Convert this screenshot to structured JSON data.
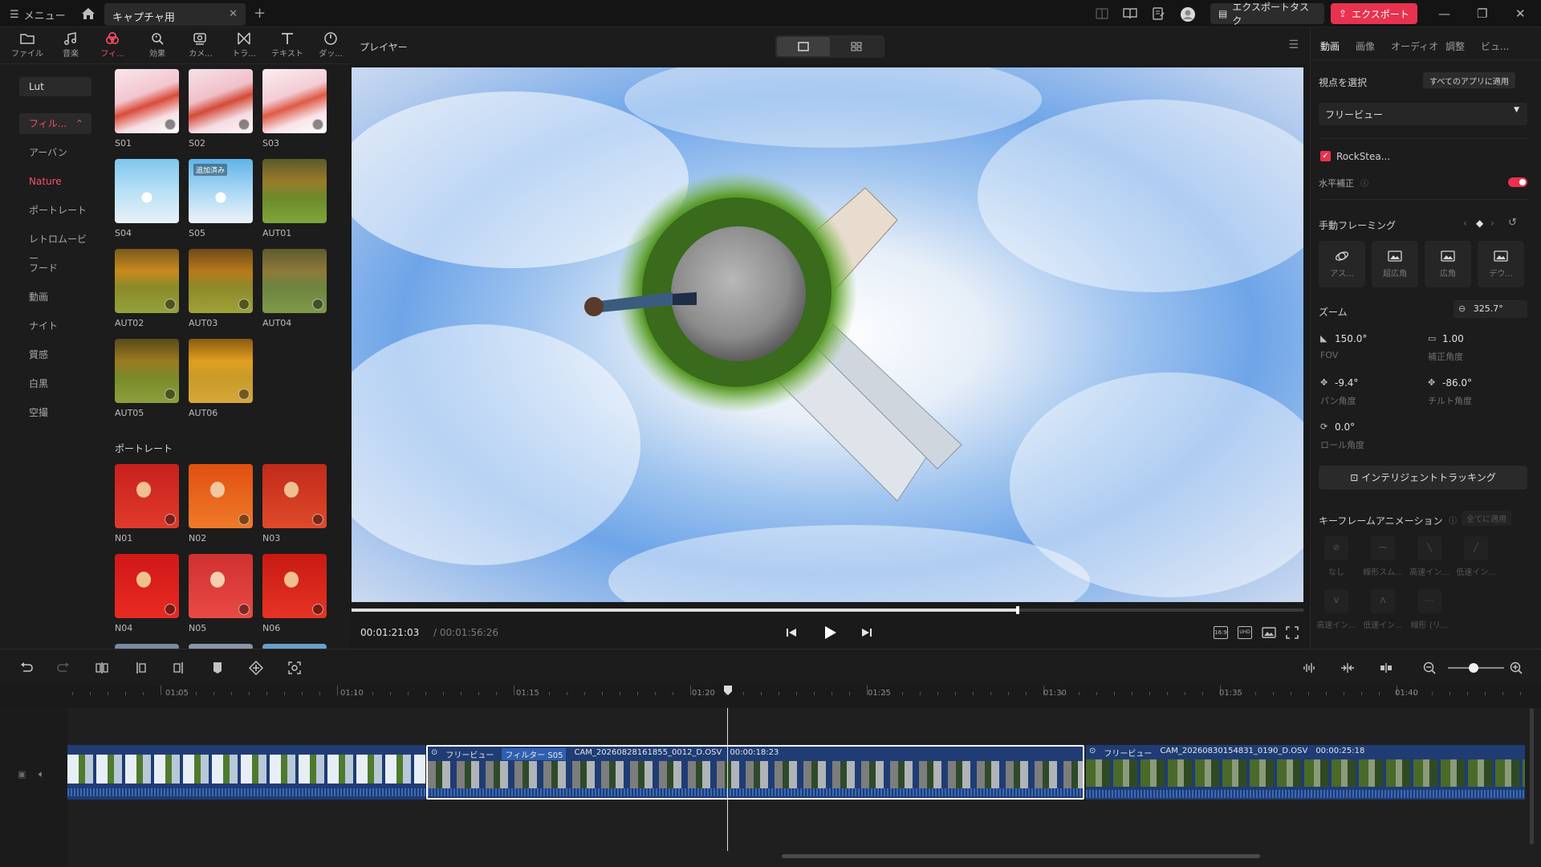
{
  "titlebar": {
    "menu_label": "メニュー",
    "tab_label": "キャプチャ用",
    "export_task_label": "エクスポートタスク",
    "export_label": "エクスポート"
  },
  "tooltabs": [
    {
      "label": "ファイル",
      "icon": "folder-icon"
    },
    {
      "label": "音楽",
      "icon": "music-icon"
    },
    {
      "label": "フィ...",
      "icon": "filter-icon",
      "active": true
    },
    {
      "label": "効果",
      "icon": "effects-icon"
    },
    {
      "label": "カメ...",
      "icon": "camera-icon"
    },
    {
      "label": "トラ...",
      "icon": "transition-icon"
    },
    {
      "label": "テキスト",
      "icon": "text-icon"
    },
    {
      "label": "ダッ...",
      "icon": "dashboard-icon"
    }
  ],
  "categories": {
    "lut": "Lut",
    "filter_group": "フィル...",
    "items": [
      "アーバン",
      "Nature",
      "ポートレート",
      "レトロムービー",
      "フード",
      "動画",
      "ナイト",
      "質感",
      "白黒",
      "空撮"
    ],
    "active": "Nature"
  },
  "thumbs": {
    "nature": [
      "S01",
      "S02",
      "S03",
      "S04",
      "S05",
      "AUT01",
      "AUT02",
      "AUT03",
      "AUT04",
      "AUT05",
      "AUT06"
    ],
    "s05_badge": "追加済み",
    "portrait_heading": "ポートレート",
    "portrait": [
      "N01",
      "N02",
      "N03",
      "N04",
      "N05",
      "N06"
    ]
  },
  "player": {
    "title": "プレイヤー",
    "current_time": "00:01:21:03",
    "total_time": "/ 00:01:56:26",
    "progress": 0.7,
    "badges": [
      "16:9",
      "UHD"
    ]
  },
  "right_panel": {
    "tabs": [
      "動画",
      "画像",
      "オーディオ",
      "調整",
      "ビュ..."
    ],
    "active_tab": "動画",
    "viewpoint_label": "視点を選択",
    "apply_all_label": "すべてのアプリに適用",
    "viewpoint_value": "フリービュー",
    "rocksteady_label": "RockStea...",
    "horizon_label": "水平補正",
    "horizon_on": true,
    "framing_label": "手動フレーミング",
    "framing_buttons": [
      "アス...",
      "超広角",
      "広角",
      "デウ..."
    ],
    "zoom_label": "ズーム",
    "zoom_value": "325.7°",
    "fov_value": "150.0°",
    "fov_label": "FOV",
    "correction_value": "1.00",
    "correction_label": "補正角度",
    "pan_value": "-9.4°",
    "pan_label": "パン角度",
    "tilt_value": "-86.0°",
    "tilt_label": "チルト角度",
    "roll_value": "0.0°",
    "roll_label": "ロール角度",
    "tracking_label": "インテリジェントトラッキング",
    "keyframe_label": "キーフレームアニメーション",
    "keyframe_apply_all": "全てに適用",
    "keyframe_buttons": [
      "なし",
      "線形スム...",
      "高速イン...",
      "低速イン...",
      "高速イン...",
      "低速イン...",
      "線形 (リ..."
    ]
  },
  "timeline": {
    "ruler_labels": [
      "01:05",
      "01:10",
      "01:15",
      "01:20",
      "01:25",
      "01:30",
      "01:35",
      "01:40"
    ],
    "clip1": {
      "view_label": "フリービュー",
      "filter_label": "フィルター S05",
      "name": "CAM_20260828161855_0012_D.OSV",
      "duration": "00:00:18:23"
    },
    "clip2": {
      "view_label": "フリービュー",
      "name": "CAM_20260830154831_0190_D.OSV",
      "duration": "00:00:25:18"
    }
  }
}
